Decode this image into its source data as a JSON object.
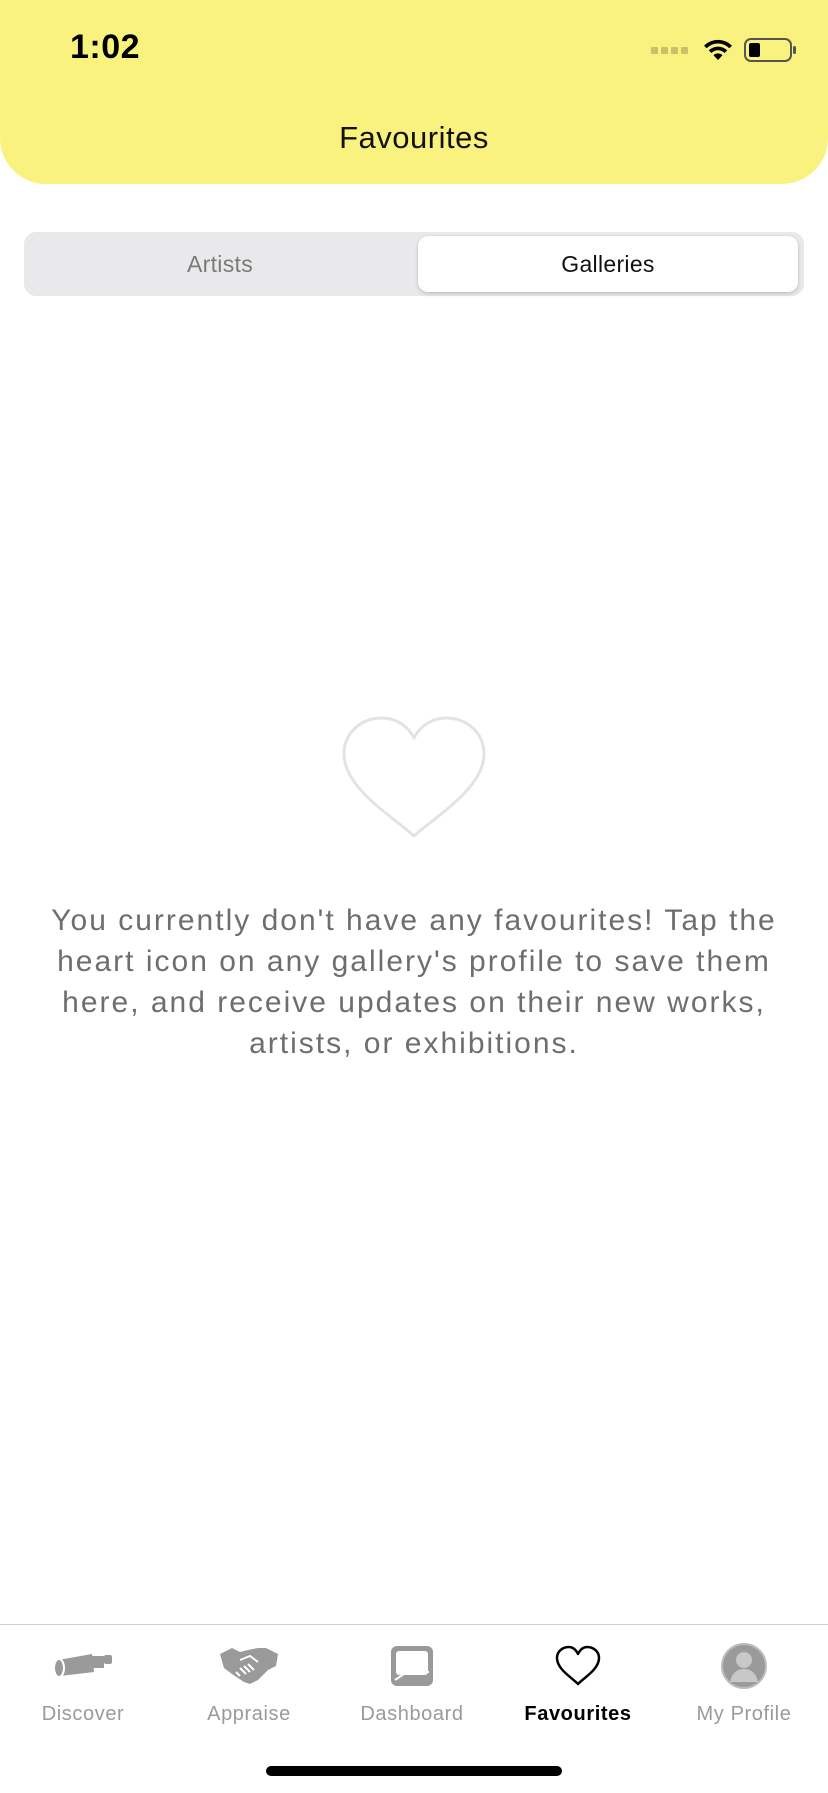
{
  "status_bar": {
    "time": "1:02",
    "icons": [
      "signal-icon",
      "wifi-icon",
      "battery-icon"
    ]
  },
  "header": {
    "title": "Favourites",
    "background_color": "#FAF27E"
  },
  "segmented_control": {
    "options": [
      {
        "label": "Artists",
        "selected": false
      },
      {
        "label": "Galleries",
        "selected": true
      }
    ]
  },
  "empty_state": {
    "icon": "heart-outline-icon",
    "message": "You currently don't have any favourites! Tap the heart icon on any gallery's profile to save them here, and receive updates on their new works, artists, or exhibitions."
  },
  "tab_bar": {
    "items": [
      {
        "label": "Discover",
        "icon": "telescope-icon",
        "active": false
      },
      {
        "label": "Appraise",
        "icon": "handshake-icon",
        "active": false
      },
      {
        "label": "Dashboard",
        "icon": "dashboard-icon",
        "active": false
      },
      {
        "label": "Favourites",
        "icon": "heart-icon",
        "active": true
      },
      {
        "label": "My Profile",
        "icon": "profile-icon",
        "active": false
      }
    ]
  }
}
